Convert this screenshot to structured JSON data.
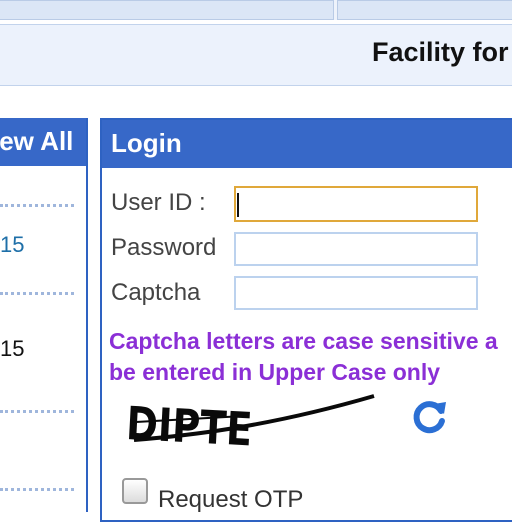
{
  "header": {
    "title": "Facility for"
  },
  "left_panel": {
    "view_all_label": "iew All",
    "items": [
      {
        "date": "15"
      },
      {
        "date": "15"
      }
    ]
  },
  "login": {
    "heading": "Login",
    "fields": {
      "user_id": {
        "label": "User ID :",
        "value": ""
      },
      "password": {
        "label": "Password",
        "value": ""
      },
      "captcha": {
        "label": "Captcha",
        "value": ""
      }
    },
    "captcha_notice": "Captcha letters are case sensitive a be entered in Upper Case only",
    "captcha_text": "DIPTE",
    "refresh_icon": "refresh-icon",
    "otp_label": "Request OTP"
  },
  "colors": {
    "accent": "#3768c8",
    "notice": "#8b2fd6",
    "focus": "#e0a83a",
    "link": "#1e6fa8"
  }
}
